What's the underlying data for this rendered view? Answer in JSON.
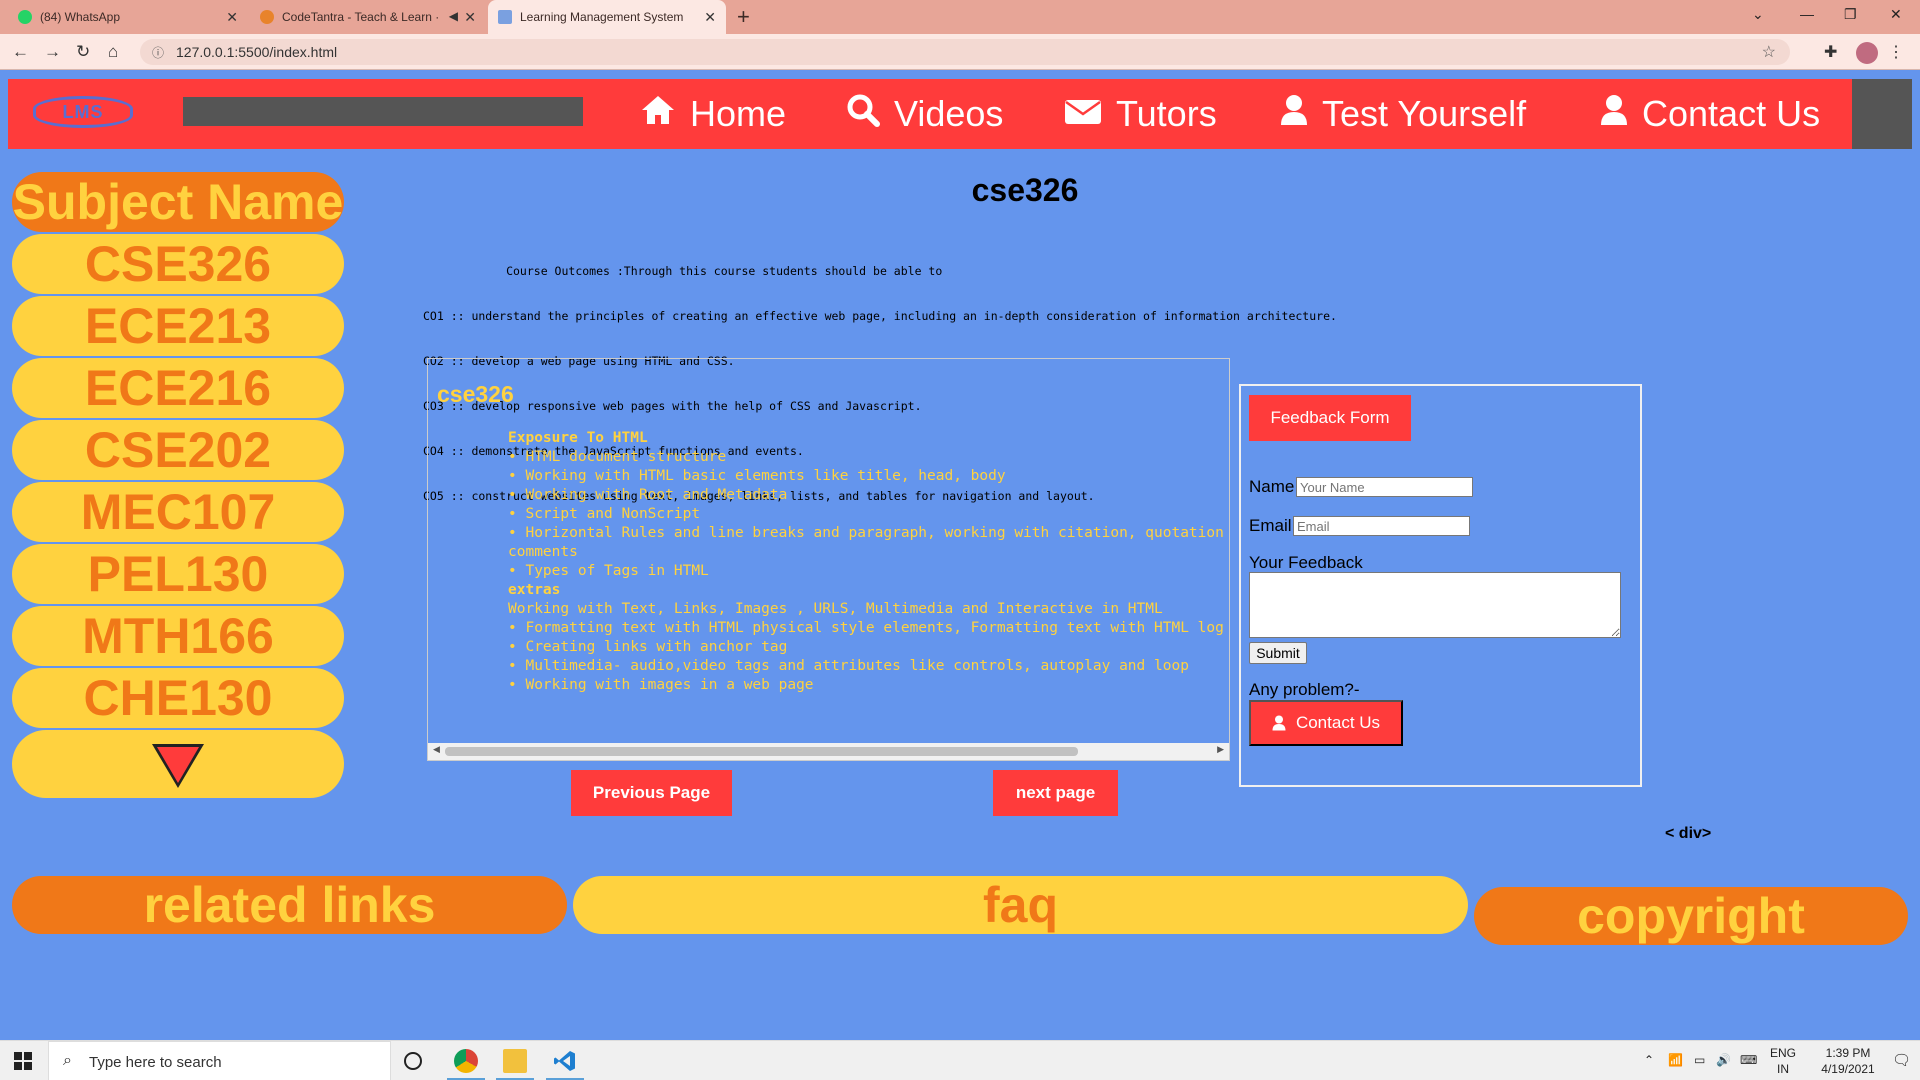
{
  "browser": {
    "tabs": [
      {
        "title": "(84) WhatsApp",
        "badge": "84"
      },
      {
        "title": "CodeTantra - Teach & Learn ·"
      },
      {
        "title": "Learning Management System"
      }
    ],
    "url": "127.0.0.1:5500/index.html"
  },
  "header": {
    "logo": "LMS",
    "nav": [
      {
        "label": "Home",
        "icon": "home-icon"
      },
      {
        "label": "Videos",
        "icon": "search-icon"
      },
      {
        "label": "Tutors",
        "icon": "envelope-icon"
      },
      {
        "label": "Test Yourself",
        "icon": "user-icon"
      },
      {
        "label": "Contact Us",
        "icon": "user-icon"
      }
    ]
  },
  "sidebar": {
    "title": "Subject Name",
    "subjects": [
      "CSE326",
      "ECE213",
      "ECE216",
      "CSE202",
      "MEC107",
      "PEL130",
      "MTH166",
      "CHE130"
    ]
  },
  "main": {
    "title": "cse326",
    "outcomes": [
      "            Course Outcomes :Through this course students should be able to",
      "CO1 :: understand the principles of creating an effective web page, including an in-depth consideration of information architecture.",
      "CO2 :: develop a web page using HTML and CSS.",
      "CO3 :: develop responsive web pages with the help of CSS and Javascript.",
      "CO4 :: demonstrate the JavaScript functions and events.",
      "CO5 :: construct websites using text, images, links, lists, and tables for navigation and layout."
    ],
    "course_heading": "cse326",
    "course_lines": [
      {
        "text": "Exposure To HTML",
        "bold": true
      },
      {
        "text": "• HTML document structure"
      },
      {
        "text": "• Working with HTML basic elements like title, head, body"
      },
      {
        "text": "• Working with Root and Metadata"
      },
      {
        "text": "• Script and NonScript"
      },
      {
        "text": "• Horizontal Rules and line breaks and paragraph, working with citation, quotation"
      },
      {
        "text": "comments"
      },
      {
        "text": "• Types of Tags in HTML"
      },
      {
        "text": "extras",
        "bold": true
      },
      {
        "text": "Working with Text, Links, Images , URLS, Multimedia and Interactive in HTML"
      },
      {
        "text": "• Formatting text with HTML physical style elements, Formatting text with HTML log"
      },
      {
        "text": "• Creating links with anchor tag"
      },
      {
        "text": "• Multimedia- audio,video tags and attributes like controls, autoplay and loop"
      },
      {
        "text": "• Working with images in a web page"
      }
    ],
    "prev_label": "Previous Page",
    "next_label": "next page",
    "div_text": "< div>"
  },
  "feedback": {
    "title": "Feedback Form",
    "name_label": "Name",
    "name_placeholder": "Your Name",
    "email_label": "Email",
    "email_placeholder": "Email",
    "feedback_label": "Your Feedback",
    "submit_label": "Submit",
    "problem_label": "Any problem?-",
    "contact_label": "Contact Us"
  },
  "footer": {
    "related": "related links",
    "faq": "faq",
    "copyright": "copyright"
  },
  "taskbar": {
    "search_placeholder": "Type here to search",
    "lang_top": "ENG",
    "lang_bottom": "IN",
    "time": "1:39 PM",
    "date": "4/19/2021"
  },
  "colors": {
    "page_bg": "#6495ed",
    "header_red": "#ff3b3b",
    "yellow": "#ffd23f",
    "orange": "#f07818"
  }
}
